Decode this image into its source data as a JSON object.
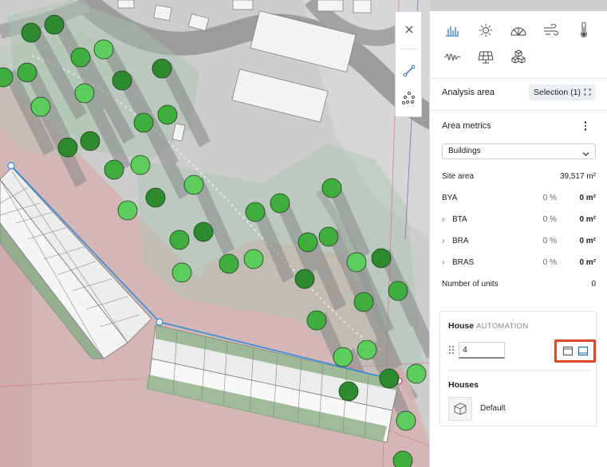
{
  "toolbar": {
    "close_icon": "close-icon",
    "line_icon": "polyline-icon",
    "points_icon": "scatter-points-icon"
  },
  "panel": {
    "analysis_tools": [
      {
        "name": "bar-chart-icon",
        "active": true
      },
      {
        "name": "sun-icon"
      },
      {
        "name": "daylight-dome-icon"
      },
      {
        "name": "wind-icon"
      },
      {
        "name": "thermometer-icon"
      },
      {
        "name": "noise-wave-icon"
      },
      {
        "name": "solar-panel-icon"
      },
      {
        "name": "volume-cubes-icon"
      }
    ],
    "analysis_area": {
      "label": "Analysis area",
      "selection": "Selection (1)"
    },
    "area_metrics": {
      "label": "Area metrics",
      "dropdown_value": "Buildings",
      "rows": [
        {
          "name": "Site area",
          "pct": "",
          "value": "39,517 m²"
        },
        {
          "name": "BYA",
          "pct": "0 %",
          "value": "0 m²"
        },
        {
          "name": "BTA",
          "pct": "0 %",
          "value": "0 m²",
          "expandable": true
        },
        {
          "name": "BRA",
          "pct": "0 %",
          "value": "0 m²",
          "expandable": true
        },
        {
          "name": "BRAS",
          "pct": "0 %",
          "value": "0 m²",
          "expandable": true
        },
        {
          "name": "Number of units",
          "pct": "",
          "value": "0"
        }
      ]
    },
    "house_card": {
      "title": "House",
      "automation": "AUTOMATION",
      "count_value": "4",
      "houses_label": "Houses",
      "default_label": "Default"
    }
  },
  "colors": {
    "accent": "#1f6fb8",
    "highlight": "#e0482a",
    "tree": "#3dac3d",
    "zone": "#d9a9a9"
  }
}
